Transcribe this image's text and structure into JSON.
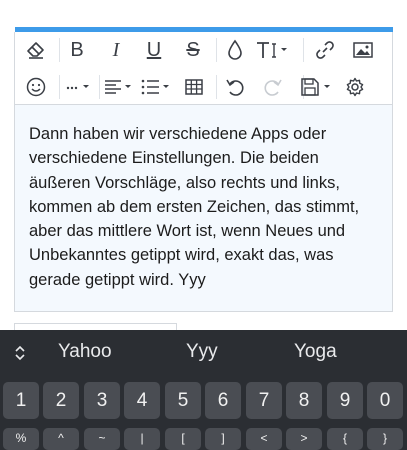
{
  "colors": {
    "accent": "#3d9be9",
    "editor_bg": "#f4f9fe",
    "keyboard_bg": "#2b2e33",
    "key_bg": "#4a4d53",
    "icon": "#3b3f46",
    "icon_disabled": "#c8ccd1"
  },
  "toolbar": {
    "icons": [
      "eraser-icon",
      "bold-icon",
      "italic-icon",
      "underline-icon",
      "strikethrough-icon",
      "color-drop-icon",
      "text-size-icon",
      "link-icon",
      "image-icon",
      "emoji-icon",
      "more-icon",
      "align-icon",
      "list-icon",
      "table-icon",
      "undo-icon",
      "redo-icon",
      "save-icon",
      "settings-icon"
    ],
    "bold_glyph": "B",
    "italic_glyph": "I",
    "underline_glyph": "U",
    "strike_glyph": "S",
    "textsize_glyph": "TI",
    "more_glyph": "···"
  },
  "editor": {
    "text": "Dann haben wir verschiedene Apps oder verschiedene Einstellungen. Die beiden äußeren Vorschläge, also rechts und links, kommen ab dem ersten Zeichen, das stimmt, aber das mittlere Wort ist, wenn Neues und Unbekanntes getippt wird, exakt das, was gerade getippt wird. Yyy"
  },
  "keyboard": {
    "suggestions": [
      "Yahoo",
      "Yyy",
      "Yoga"
    ],
    "number_row": [
      "1",
      "2",
      "3",
      "4",
      "5",
      "6",
      "7",
      "8",
      "9",
      "0"
    ],
    "symbol_row": [
      "%",
      "^",
      "~",
      "|",
      "[",
      "]",
      "<",
      ">",
      "{",
      "}"
    ]
  }
}
